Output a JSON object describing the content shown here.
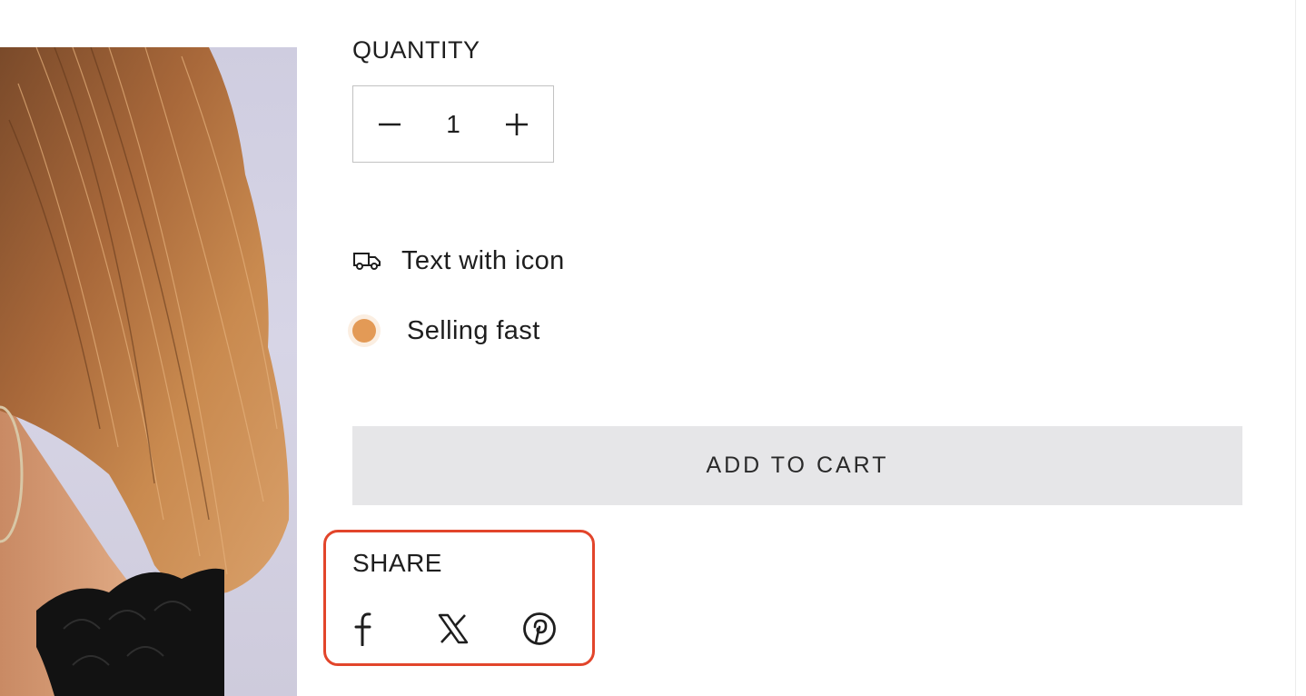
{
  "product": {
    "quantity": {
      "label": "QUANTITY",
      "value": "1",
      "decrease_icon": "minus-icon",
      "increase_icon": "plus-icon"
    },
    "shipping": {
      "icon": "truck-icon",
      "text": "Text with icon"
    },
    "stock": {
      "text": "Selling fast",
      "dot_color": "#e39a56"
    },
    "add_to_cart": {
      "label": "ADD TO CART",
      "background": "#e6e6e8"
    },
    "share": {
      "label": "SHARE",
      "highlight_color": "#e2452b",
      "icons": [
        "facebook-icon",
        "x-icon",
        "pinterest-icon"
      ]
    }
  },
  "image": {
    "alt_subject": "woman-with-hoop-earring-icon"
  }
}
